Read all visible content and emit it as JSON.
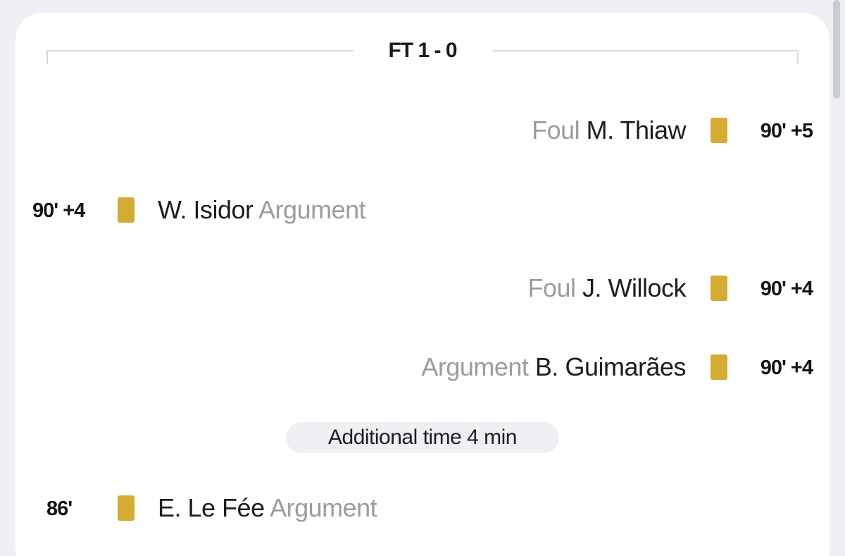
{
  "header": {
    "score": "FT 1 - 0"
  },
  "events": [
    {
      "minute": "90' +5",
      "player": "M. Thiaw",
      "reason": "Foul",
      "card": "yellow-card-icon"
    },
    {
      "minute": "90' +4",
      "player": "W. Isidor",
      "reason": "Argument",
      "card": "yellow-card-icon"
    },
    {
      "minute": "90' +4",
      "player": "J. Willock",
      "reason": "Foul",
      "card": "yellow-card-icon"
    },
    {
      "minute": "90' +4",
      "player": "B. Guimarães",
      "reason": "Argument",
      "card": "yellow-card-icon"
    },
    {
      "minute": "86'",
      "player": "E. Le Fée",
      "reason": "Argument",
      "card": "yellow-card-icon"
    }
  ],
  "additional_time": "Additional time 4 min",
  "colors": {
    "yellow_card": "#d4ac32",
    "reason_text": "#9a9ca1",
    "background": "#eef0f4"
  }
}
